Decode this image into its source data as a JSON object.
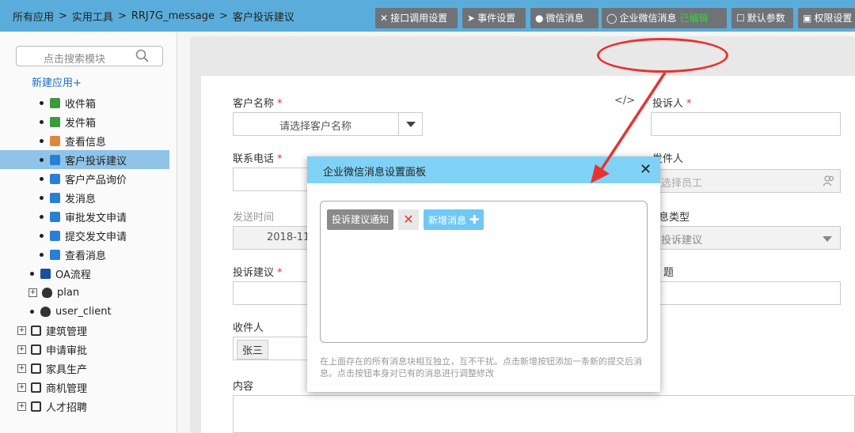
{
  "breadcrumb": [
    "所有应用",
    "实用工具",
    "RRJ7G_message",
    "客户投诉建议"
  ],
  "breadcrumb_sep": ">",
  "sidebar": {
    "search_placeholder": "点击搜索模块",
    "new_app": "新建应用+",
    "items": [
      {
        "label": "收件箱",
        "icon": "excel-icon"
      },
      {
        "label": "发件箱",
        "icon": "excel-icon"
      },
      {
        "label": "查看信息",
        "icon": "form-icon"
      },
      {
        "label": "客户投诉建议",
        "icon": "doc-icon",
        "selected": true
      },
      {
        "label": "客户产品询价",
        "icon": "doc-icon"
      },
      {
        "label": "发消息",
        "icon": "doc-icon"
      },
      {
        "label": "审批发文申请",
        "icon": "doc-icon"
      },
      {
        "label": "提交发文申请",
        "icon": "doc-icon"
      },
      {
        "label": "查看消息",
        "icon": "doc-icon"
      },
      {
        "label": "OA流程",
        "icon": "org-chart-icon"
      },
      {
        "label": "plan",
        "icon": "database-icon"
      },
      {
        "label": "user_client",
        "icon": "database-icon"
      },
      {
        "label": "建筑管理",
        "icon": "cube-icon"
      },
      {
        "label": "申请审批",
        "icon": "cube-icon"
      },
      {
        "label": "家具生产",
        "icon": "cube-icon"
      },
      {
        "label": "商机管理",
        "icon": "cube-icon"
      },
      {
        "label": "人才招聘",
        "icon": "cube-icon"
      }
    ]
  },
  "toolbar": {
    "api": "接口调用设置",
    "event": "事件设置",
    "wechat": "微信消息",
    "enterprise_wechat": "企业微信消息",
    "enterprise_wechat_status": "已编辑",
    "defaults": "默认参数",
    "permission": "权限设置"
  },
  "form": {
    "customer_name_label": "客户名称",
    "customer_name_placeholder": "请选择客户名称",
    "code_icon": "</>",
    "complainant_label": "投诉人",
    "phone_label": "联系电话",
    "sender_label": "发件人",
    "sender_placeholder": "选择员工",
    "send_time_label": "发送时间",
    "send_time_value": "2018-11",
    "message_type_label": "息类型",
    "message_type_value": "投诉建议",
    "complaint_label": "投诉建议",
    "subject_label": "题",
    "recipient_label": "收件人",
    "recipient_value": "张三",
    "content_label": "内容",
    "required_mark": "*"
  },
  "modal": {
    "title": "企业微信消息设置面板",
    "close": "✕",
    "tag_existing": "投诉建议通知",
    "tag_remove": "✕",
    "tag_new": "新增消息",
    "note": "在上面存在的所有消息块相互独立，互不干扰。点击新增按钮添加一条新的提交后消息。点击按钮本身对已有的消息进行调整修改"
  },
  "colors": {
    "topbar": "#5aaddb",
    "modal_header": "#7fd2f5",
    "annotation": "#e83232",
    "selected_row": "#8fc3e8"
  }
}
